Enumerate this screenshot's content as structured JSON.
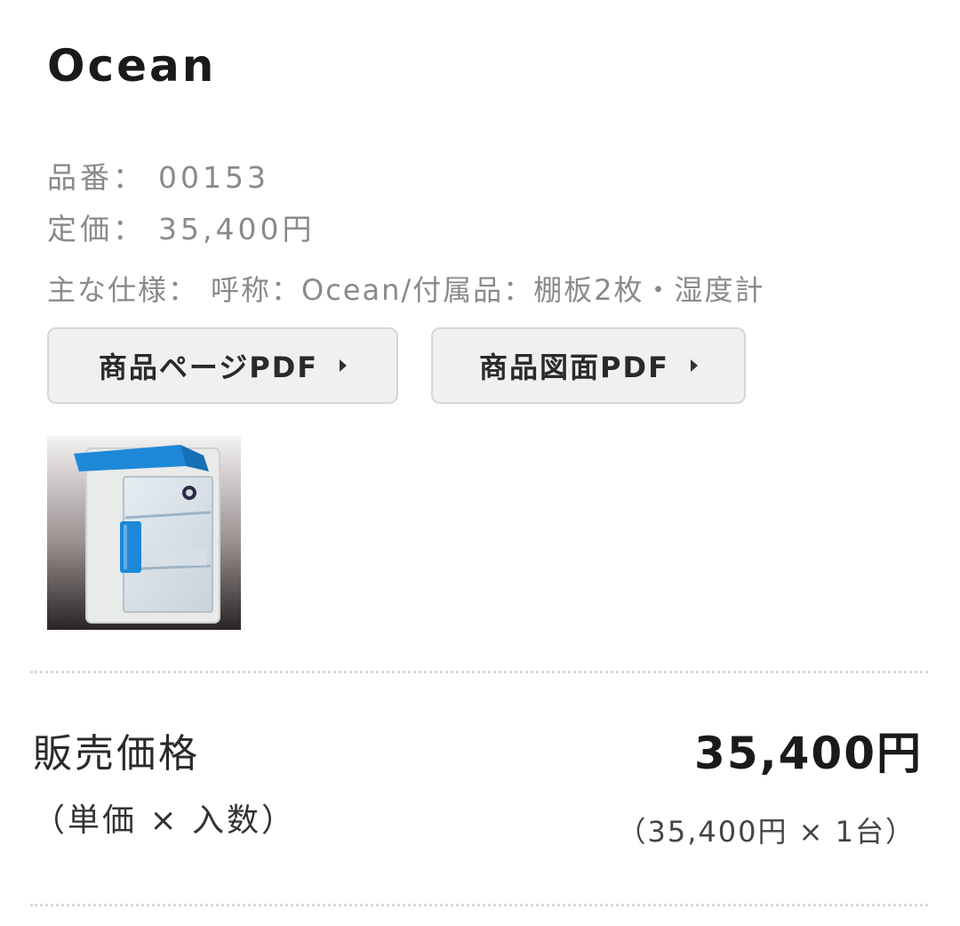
{
  "product": {
    "name": "Ocean",
    "code_label": "品番：",
    "code_value": "00153",
    "list_price_label": "定価：",
    "list_price_value": "35,400円",
    "spec_label": "主な仕様：",
    "spec_value": "呼称：Ocean/付属品：棚板2枚・湿度計"
  },
  "buttons": {
    "product_page_pdf": "商品ページPDF",
    "product_drawing_pdf": "商品図面PDF"
  },
  "icons": {
    "button_arrow": "caret-right-icon"
  },
  "price": {
    "label": "販売価格",
    "sub_label": "（単価 × 入数）",
    "total": "35,400円",
    "calculation": "（35,400円 × 1台）"
  },
  "colors": {
    "accent_blue": "#1e88d8",
    "button_bg": "#f0f0f0",
    "muted_text": "#8a8a8a"
  }
}
